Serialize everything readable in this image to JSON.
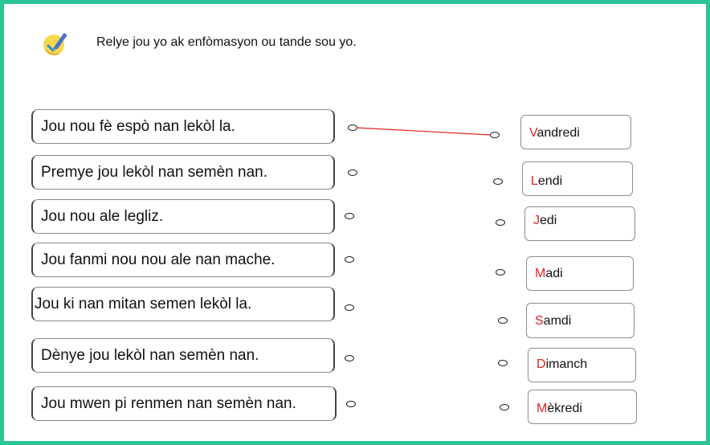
{
  "instruction": {
    "text": "Relye jou yo ak enfòmasyon ou tande sou yo.",
    "icon": "pencil-check-icon"
  },
  "clues": [
    "Jou nou fè espò nan lekòl la.",
    "Premye jou lekòl nan semèn nan.",
    "Jou nou ale legliz.",
    "Jou fanmi nou nou ale nan mache.",
    "Jou ki nan mitan semen lekòl la.",
    "Dènye jou lekòl nan semèn nan.",
    "Jou mwen pi renmen nan semèn nan."
  ],
  "days": [
    {
      "first": "V",
      "rest": "andredi"
    },
    {
      "first": "L",
      "rest": "endi"
    },
    {
      "first": "J",
      "rest": "edi"
    },
    {
      "first": "M",
      "rest": "adi"
    },
    {
      "first": "S",
      "rest": "amdi"
    },
    {
      "first": "D",
      "rest": "imanch"
    },
    {
      "first": "M",
      "rest": "èkredi"
    }
  ],
  "connections": [
    {
      "clue_index": 0,
      "day_index": 0
    }
  ],
  "colors": {
    "frame": "#2cc598",
    "first_letter": "#e32222",
    "connector_line": "#e32222"
  }
}
